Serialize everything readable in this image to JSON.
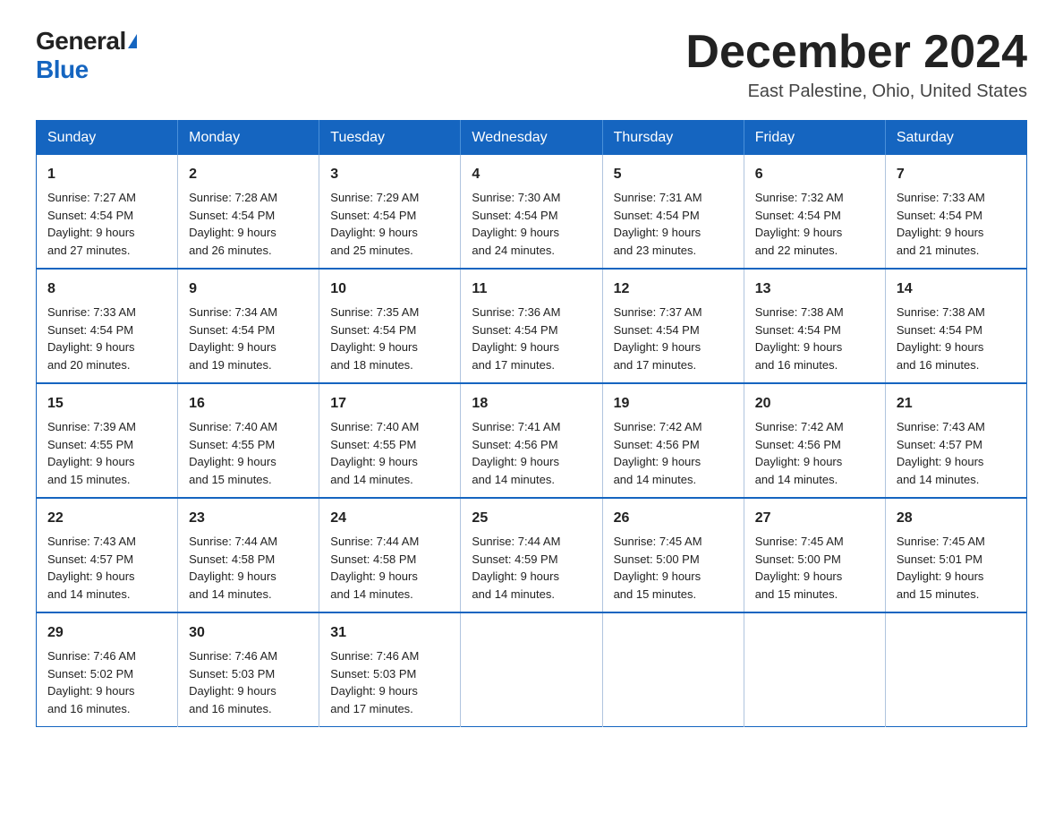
{
  "header": {
    "logo": {
      "general": "General",
      "blue": "Blue"
    },
    "title": "December 2024",
    "location": "East Palestine, Ohio, United States"
  },
  "weekdays": [
    "Sunday",
    "Monday",
    "Tuesday",
    "Wednesday",
    "Thursday",
    "Friday",
    "Saturday"
  ],
  "weeks": [
    [
      {
        "day": "1",
        "sunrise": "7:27 AM",
        "sunset": "4:54 PM",
        "daylight": "9 hours and 27 minutes."
      },
      {
        "day": "2",
        "sunrise": "7:28 AM",
        "sunset": "4:54 PM",
        "daylight": "9 hours and 26 minutes."
      },
      {
        "day": "3",
        "sunrise": "7:29 AM",
        "sunset": "4:54 PM",
        "daylight": "9 hours and 25 minutes."
      },
      {
        "day": "4",
        "sunrise": "7:30 AM",
        "sunset": "4:54 PM",
        "daylight": "9 hours and 24 minutes."
      },
      {
        "day": "5",
        "sunrise": "7:31 AM",
        "sunset": "4:54 PM",
        "daylight": "9 hours and 23 minutes."
      },
      {
        "day": "6",
        "sunrise": "7:32 AM",
        "sunset": "4:54 PM",
        "daylight": "9 hours and 22 minutes."
      },
      {
        "day": "7",
        "sunrise": "7:33 AM",
        "sunset": "4:54 PM",
        "daylight": "9 hours and 21 minutes."
      }
    ],
    [
      {
        "day": "8",
        "sunrise": "7:33 AM",
        "sunset": "4:54 PM",
        "daylight": "9 hours and 20 minutes."
      },
      {
        "day": "9",
        "sunrise": "7:34 AM",
        "sunset": "4:54 PM",
        "daylight": "9 hours and 19 minutes."
      },
      {
        "day": "10",
        "sunrise": "7:35 AM",
        "sunset": "4:54 PM",
        "daylight": "9 hours and 18 minutes."
      },
      {
        "day": "11",
        "sunrise": "7:36 AM",
        "sunset": "4:54 PM",
        "daylight": "9 hours and 17 minutes."
      },
      {
        "day": "12",
        "sunrise": "7:37 AM",
        "sunset": "4:54 PM",
        "daylight": "9 hours and 17 minutes."
      },
      {
        "day": "13",
        "sunrise": "7:38 AM",
        "sunset": "4:54 PM",
        "daylight": "9 hours and 16 minutes."
      },
      {
        "day": "14",
        "sunrise": "7:38 AM",
        "sunset": "4:54 PM",
        "daylight": "9 hours and 16 minutes."
      }
    ],
    [
      {
        "day": "15",
        "sunrise": "7:39 AM",
        "sunset": "4:55 PM",
        "daylight": "9 hours and 15 minutes."
      },
      {
        "day": "16",
        "sunrise": "7:40 AM",
        "sunset": "4:55 PM",
        "daylight": "9 hours and 15 minutes."
      },
      {
        "day": "17",
        "sunrise": "7:40 AM",
        "sunset": "4:55 PM",
        "daylight": "9 hours and 14 minutes."
      },
      {
        "day": "18",
        "sunrise": "7:41 AM",
        "sunset": "4:56 PM",
        "daylight": "9 hours and 14 minutes."
      },
      {
        "day": "19",
        "sunrise": "7:42 AM",
        "sunset": "4:56 PM",
        "daylight": "9 hours and 14 minutes."
      },
      {
        "day": "20",
        "sunrise": "7:42 AM",
        "sunset": "4:56 PM",
        "daylight": "9 hours and 14 minutes."
      },
      {
        "day": "21",
        "sunrise": "7:43 AM",
        "sunset": "4:57 PM",
        "daylight": "9 hours and 14 minutes."
      }
    ],
    [
      {
        "day": "22",
        "sunrise": "7:43 AM",
        "sunset": "4:57 PM",
        "daylight": "9 hours and 14 minutes."
      },
      {
        "day": "23",
        "sunrise": "7:44 AM",
        "sunset": "4:58 PM",
        "daylight": "9 hours and 14 minutes."
      },
      {
        "day": "24",
        "sunrise": "7:44 AM",
        "sunset": "4:58 PM",
        "daylight": "9 hours and 14 minutes."
      },
      {
        "day": "25",
        "sunrise": "7:44 AM",
        "sunset": "4:59 PM",
        "daylight": "9 hours and 14 minutes."
      },
      {
        "day": "26",
        "sunrise": "7:45 AM",
        "sunset": "5:00 PM",
        "daylight": "9 hours and 15 minutes."
      },
      {
        "day": "27",
        "sunrise": "7:45 AM",
        "sunset": "5:00 PM",
        "daylight": "9 hours and 15 minutes."
      },
      {
        "day": "28",
        "sunrise": "7:45 AM",
        "sunset": "5:01 PM",
        "daylight": "9 hours and 15 minutes."
      }
    ],
    [
      {
        "day": "29",
        "sunrise": "7:46 AM",
        "sunset": "5:02 PM",
        "daylight": "9 hours and 16 minutes."
      },
      {
        "day": "30",
        "sunrise": "7:46 AM",
        "sunset": "5:03 PM",
        "daylight": "9 hours and 16 minutes."
      },
      {
        "day": "31",
        "sunrise": "7:46 AM",
        "sunset": "5:03 PM",
        "daylight": "9 hours and 17 minutes."
      },
      null,
      null,
      null,
      null
    ]
  ],
  "labels": {
    "sunrise": "Sunrise:",
    "sunset": "Sunset:",
    "daylight": "Daylight:"
  }
}
